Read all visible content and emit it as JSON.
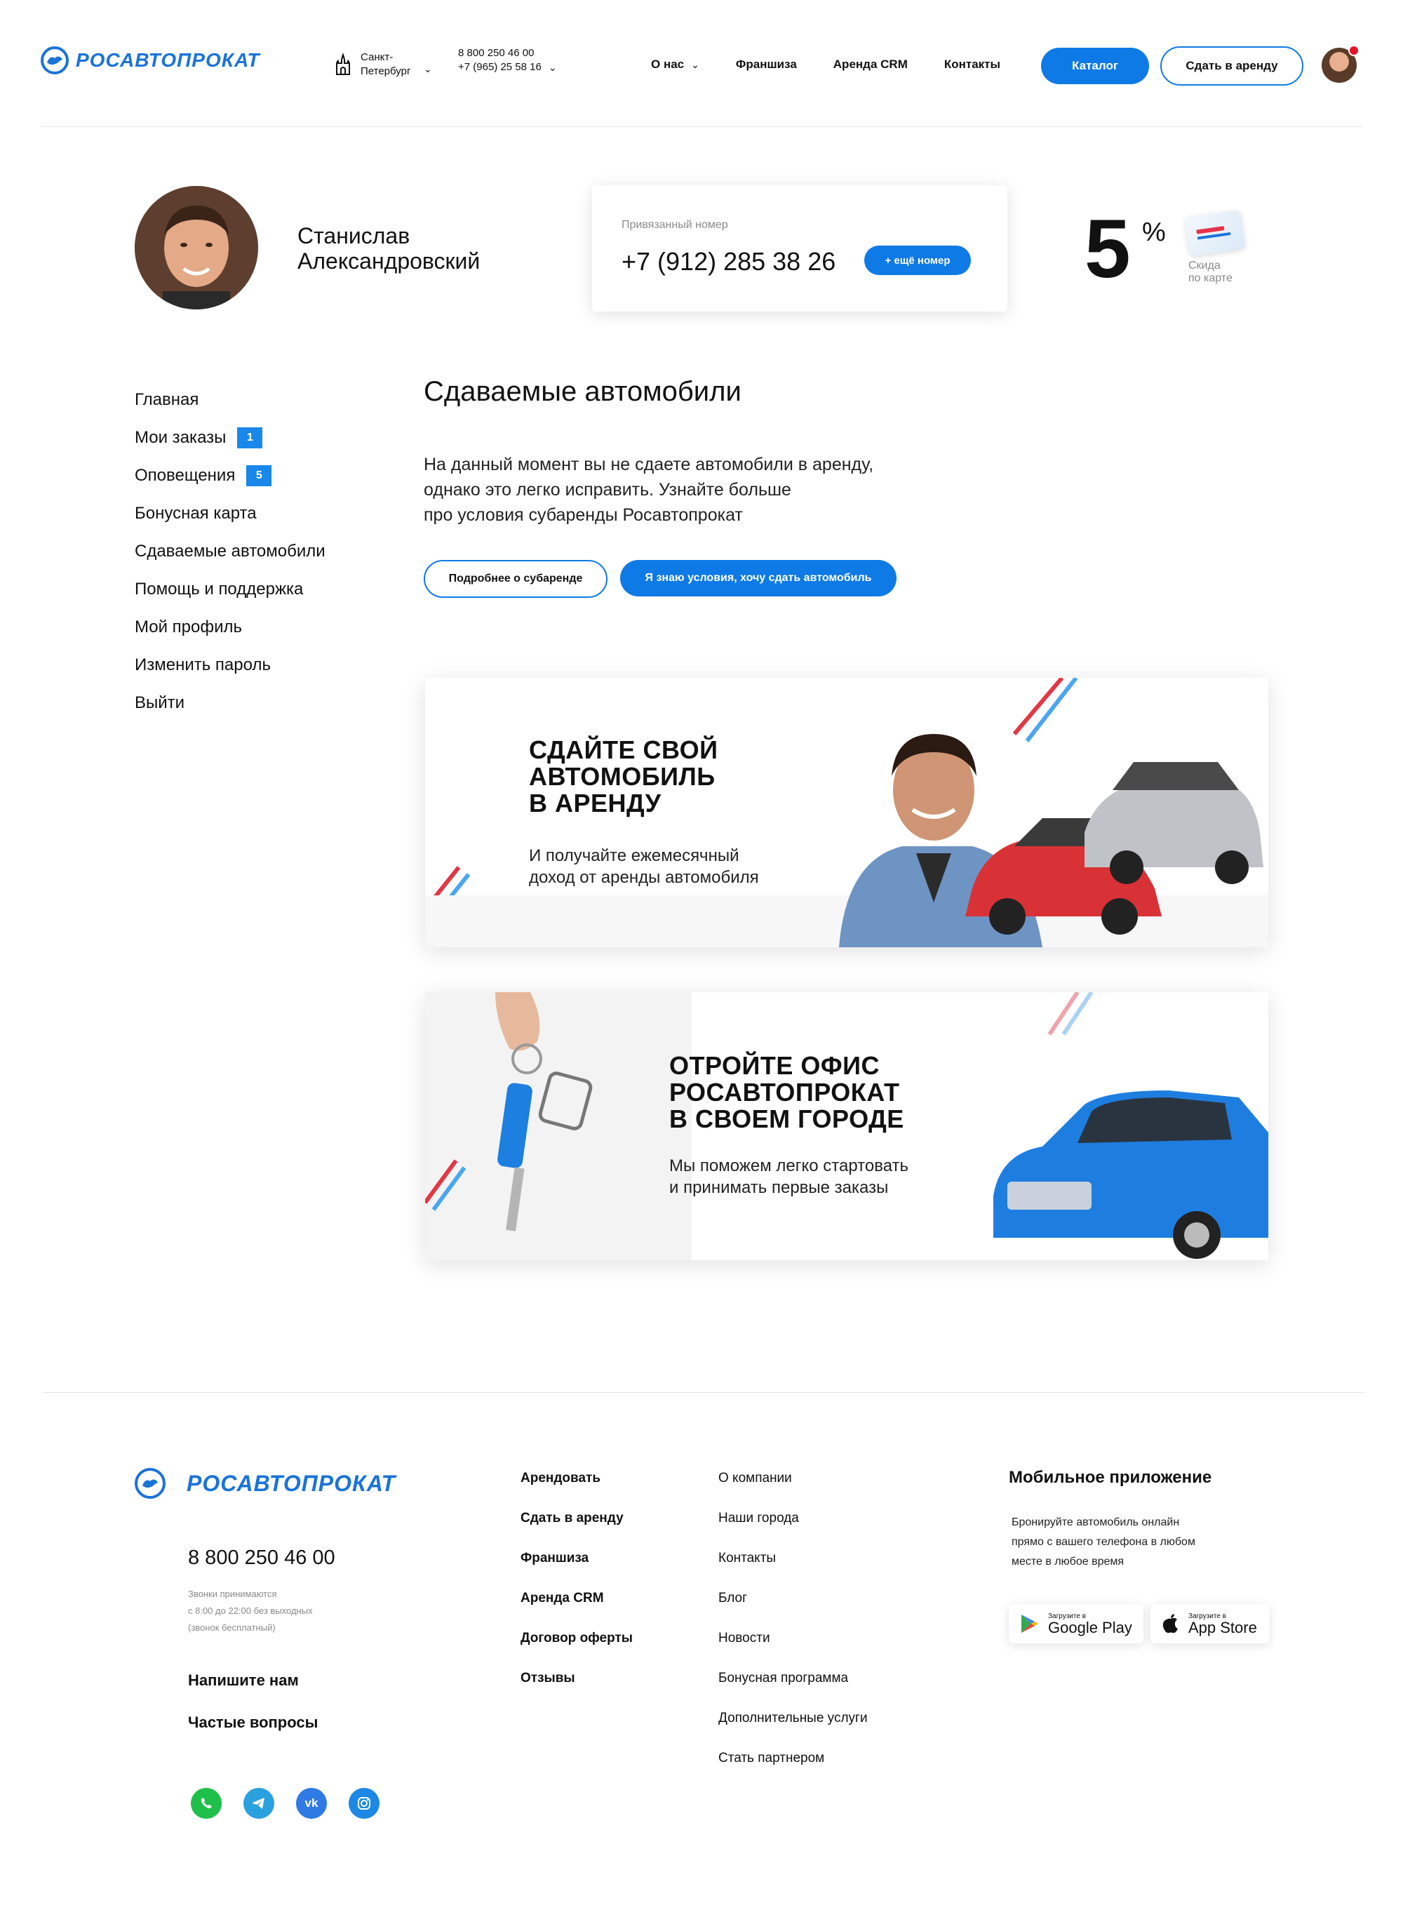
{
  "header": {
    "logo_text": "РОСАВТОПРОКАТ",
    "city": "Санкт-\nПетербург",
    "phone_1": "8 800 250 46 00",
    "phone_2": "+7 (965) 25 58 16",
    "nav": [
      "О нас",
      "Франшиза",
      "Аренда CRM",
      "Контакты"
    ],
    "catalog_label": "Каталог",
    "rent_out_label": "Сдать в аренду"
  },
  "profile": {
    "name_line1": "Станислав",
    "name_line2": "Александровский",
    "phone_label": "Привязанный номер",
    "phone": "+7 (912) 285 38 26",
    "more_phone_label": "+ ещё номер",
    "discount_value": "5",
    "discount_unit": "%",
    "discount_caption_1": "Скида",
    "discount_caption_2": "по карте"
  },
  "menu": {
    "items": [
      {
        "label": "Главная",
        "badge": ""
      },
      {
        "label": "Мои заказы",
        "badge": "1"
      },
      {
        "label": "Оповещения",
        "badge": "5"
      },
      {
        "label": "Бонусная карта",
        "badge": ""
      },
      {
        "label": "Сдаваемые автомобили",
        "badge": ""
      },
      {
        "label": "Помощь и поддержка",
        "badge": ""
      },
      {
        "label": "Мой профиль",
        "badge": ""
      },
      {
        "label": "Изменить пароль",
        "badge": ""
      },
      {
        "label": "Выйти",
        "badge": ""
      }
    ]
  },
  "main": {
    "title": "Сдаваемые автомобили",
    "desc_line1": "На данный момент вы не сдаете автомобили в аренду,",
    "desc_line2": "однако это легко исправить. Узнайте больше",
    "desc_line3": "про условия субаренды Росавтопрокат",
    "btn_more": "Подробнее о субаренде",
    "btn_agree": "Я знаю условия, хочу сдать автомобиль"
  },
  "banner1": {
    "title_1": "СДАЙТЕ СВОЙ",
    "title_2": "АВТОМОБИЛЬ",
    "title_3": "В АРЕНДУ",
    "sub_1": "И получайте ежемесячный",
    "sub_2": "доход от аренды автомобиля"
  },
  "banner2": {
    "title_1": "ОТРОЙТЕ ОФИС",
    "title_2": "РОСАВТОПРОКАТ",
    "title_3": "В СВОЕМ ГОРОДЕ",
    "sub_1": "Мы поможем легко стартовать",
    "sub_2": "и принимать первые заказы"
  },
  "footer": {
    "logo_text": "РОСАВТОПРОКАТ",
    "phone": "8 800 250 46 00",
    "hours_1": "Звонки принимаются",
    "hours_2": "с 8:00 до 22:00 без выходных",
    "hours_3": "(звонок бесплатный)",
    "write_us": "Напишите нам",
    "faq": "Частые вопросы",
    "col1": [
      "Арендовать",
      "Сдать в аренду",
      "Франшиза",
      "Аренда CRM",
      "Договор оферты",
      "Отзывы"
    ],
    "col2": [
      "О компании",
      "Наши города",
      "Контакты",
      "Блог",
      "Новости",
      "Бонусная программа",
      "Дополнительные услуги",
      "Стать партнером"
    ],
    "app_title": "Мобильное приложение",
    "app_desc_1": "Бронируйте автомобиль онлайн",
    "app_desc_2": "прямо с вашего телефона в любом",
    "app_desc_3": "месте в любое время",
    "gp_small": "Загрузите в",
    "gp_big": "Google Play",
    "as_small": "Загрузите в",
    "as_big": "App Store"
  },
  "colors": {
    "accent": "#0e7ae6",
    "badge": "#1a87ea",
    "notify_dot": "#e8132a"
  }
}
